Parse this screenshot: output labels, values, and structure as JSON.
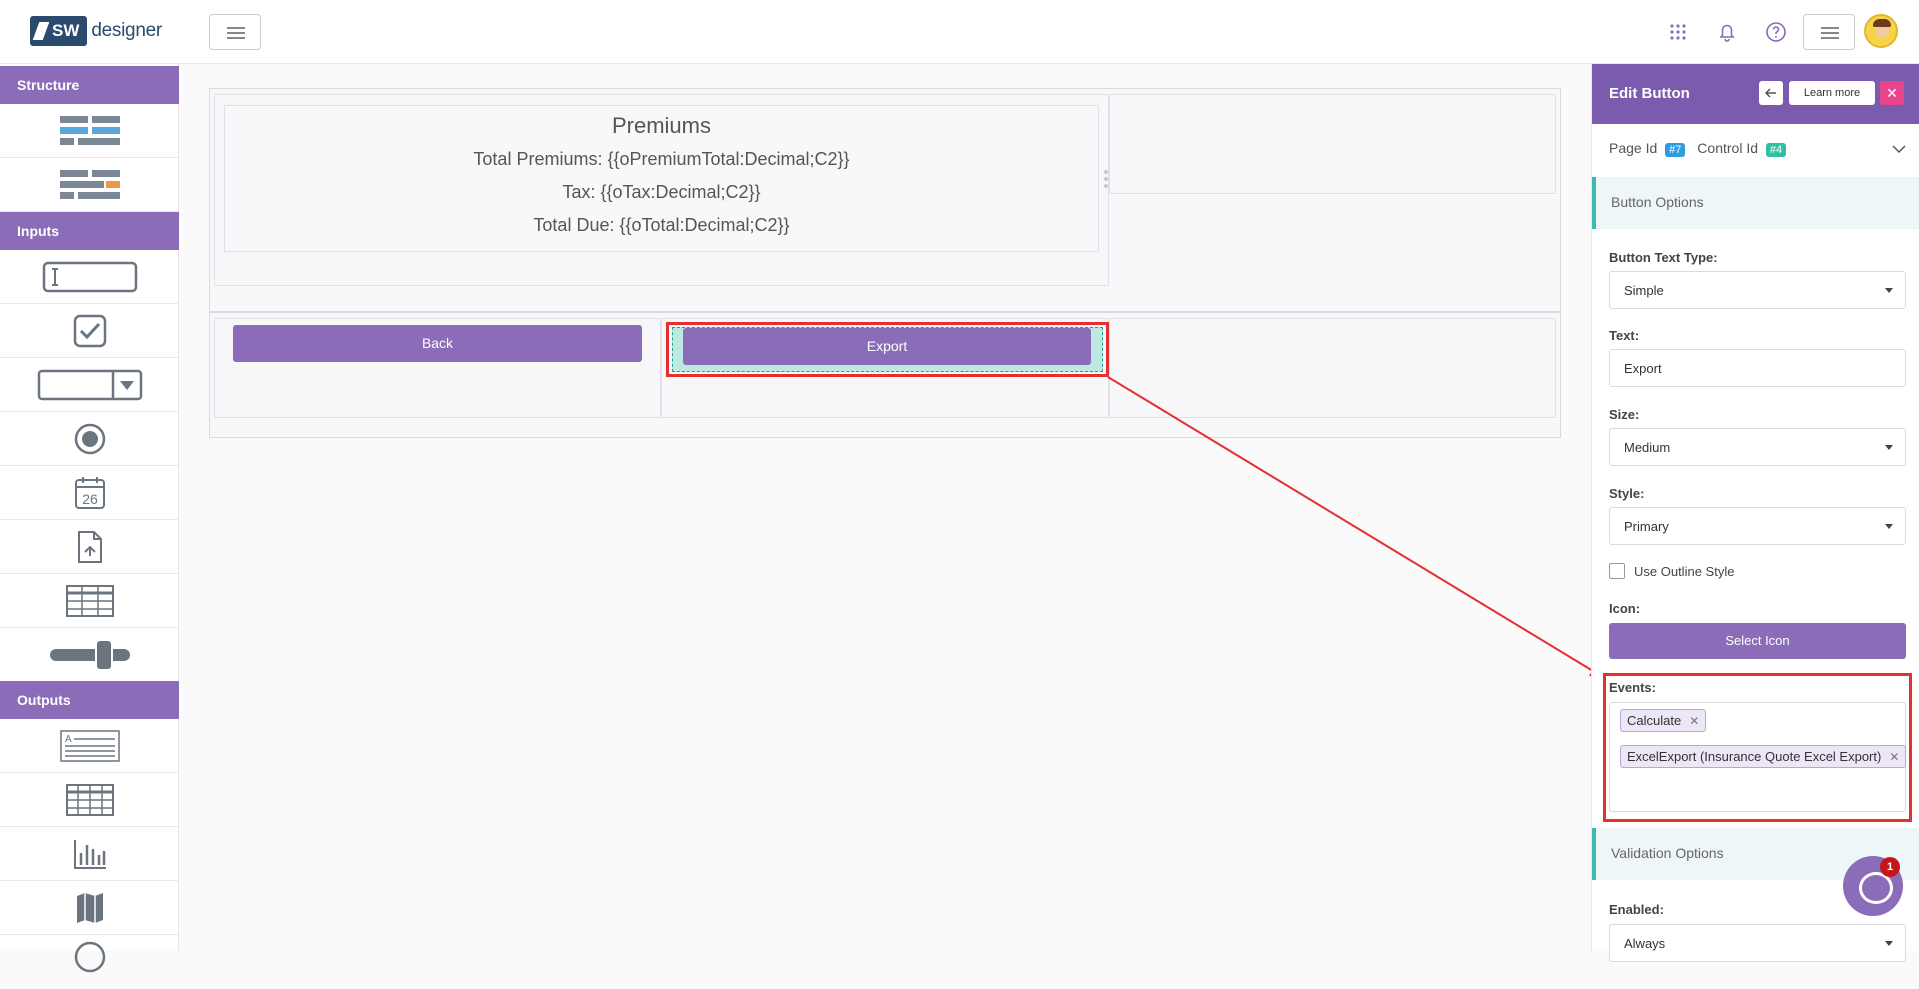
{
  "app": {
    "logo_badge": "SW",
    "logo_name": "designer"
  },
  "sidebar": {
    "structure_title": "Structure",
    "inputs_title": "Inputs",
    "outputs_title": "Outputs"
  },
  "canvas": {
    "premiums_title": "Premiums",
    "line1": "Total Premiums: {{oPremiumTotal:Decimal;C2}}",
    "line2": "Tax: {{oTax:Decimal;C2}}",
    "line3": "Total Due: {{oTotal:Decimal;C2}}",
    "back_label": "Back",
    "export_label": "Export",
    "calendar_day": "26"
  },
  "panel": {
    "title": "Edit Button",
    "learn_more": "Learn more",
    "page_id_label": "Page Id",
    "page_id_value": "#7",
    "control_id_label": "Control Id",
    "control_id_value": "#4",
    "button_options": "Button Options",
    "text_type_label": "Button Text Type:",
    "text_type_value": "Simple",
    "text_label": "Text:",
    "text_value": "Export",
    "size_label": "Size:",
    "size_value": "Medium",
    "style_label": "Style:",
    "style_value": "Primary",
    "outline_label": "Use Outline Style",
    "icon_label": "Icon:",
    "select_icon": "Select Icon",
    "events_label": "Events:",
    "events": [
      "Calculate",
      "ExcelExport (Insurance Quote Excel Export)"
    ],
    "validation_options": "Validation Options",
    "enabled_label": "Enabled:",
    "enabled_value": "Always"
  },
  "chat": {
    "badge_count": "1"
  },
  "colors": {
    "brand": "#8a6cb8",
    "header": "#7b5bae",
    "highlight": "#e53030",
    "teal": "#3cb8b5"
  }
}
